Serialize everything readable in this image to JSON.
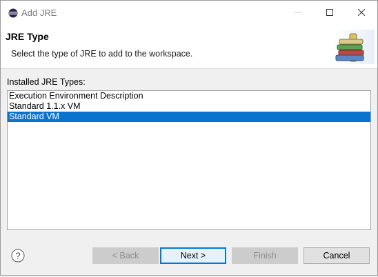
{
  "window": {
    "title": "Add JRE"
  },
  "header": {
    "title": "JRE Type",
    "description": "Select the type of JRE to add to the workspace."
  },
  "list": {
    "label": "Installed JRE Types:",
    "items": [
      {
        "label": "Execution Environment Description",
        "selected": false
      },
      {
        "label": "Standard 1.1.x VM",
        "selected": false
      },
      {
        "label": "Standard VM",
        "selected": true
      }
    ]
  },
  "footer": {
    "back_label": "< Back",
    "next_label": "Next >",
    "finish_label": "Finish",
    "cancel_label": "Cancel"
  },
  "colors": {
    "selection": "#0a72cf",
    "default_button_border": "#0078d7"
  },
  "icons": {
    "title_icon": "eclipse-icon",
    "header_image": "books-library-icon",
    "help": "help-icon"
  }
}
